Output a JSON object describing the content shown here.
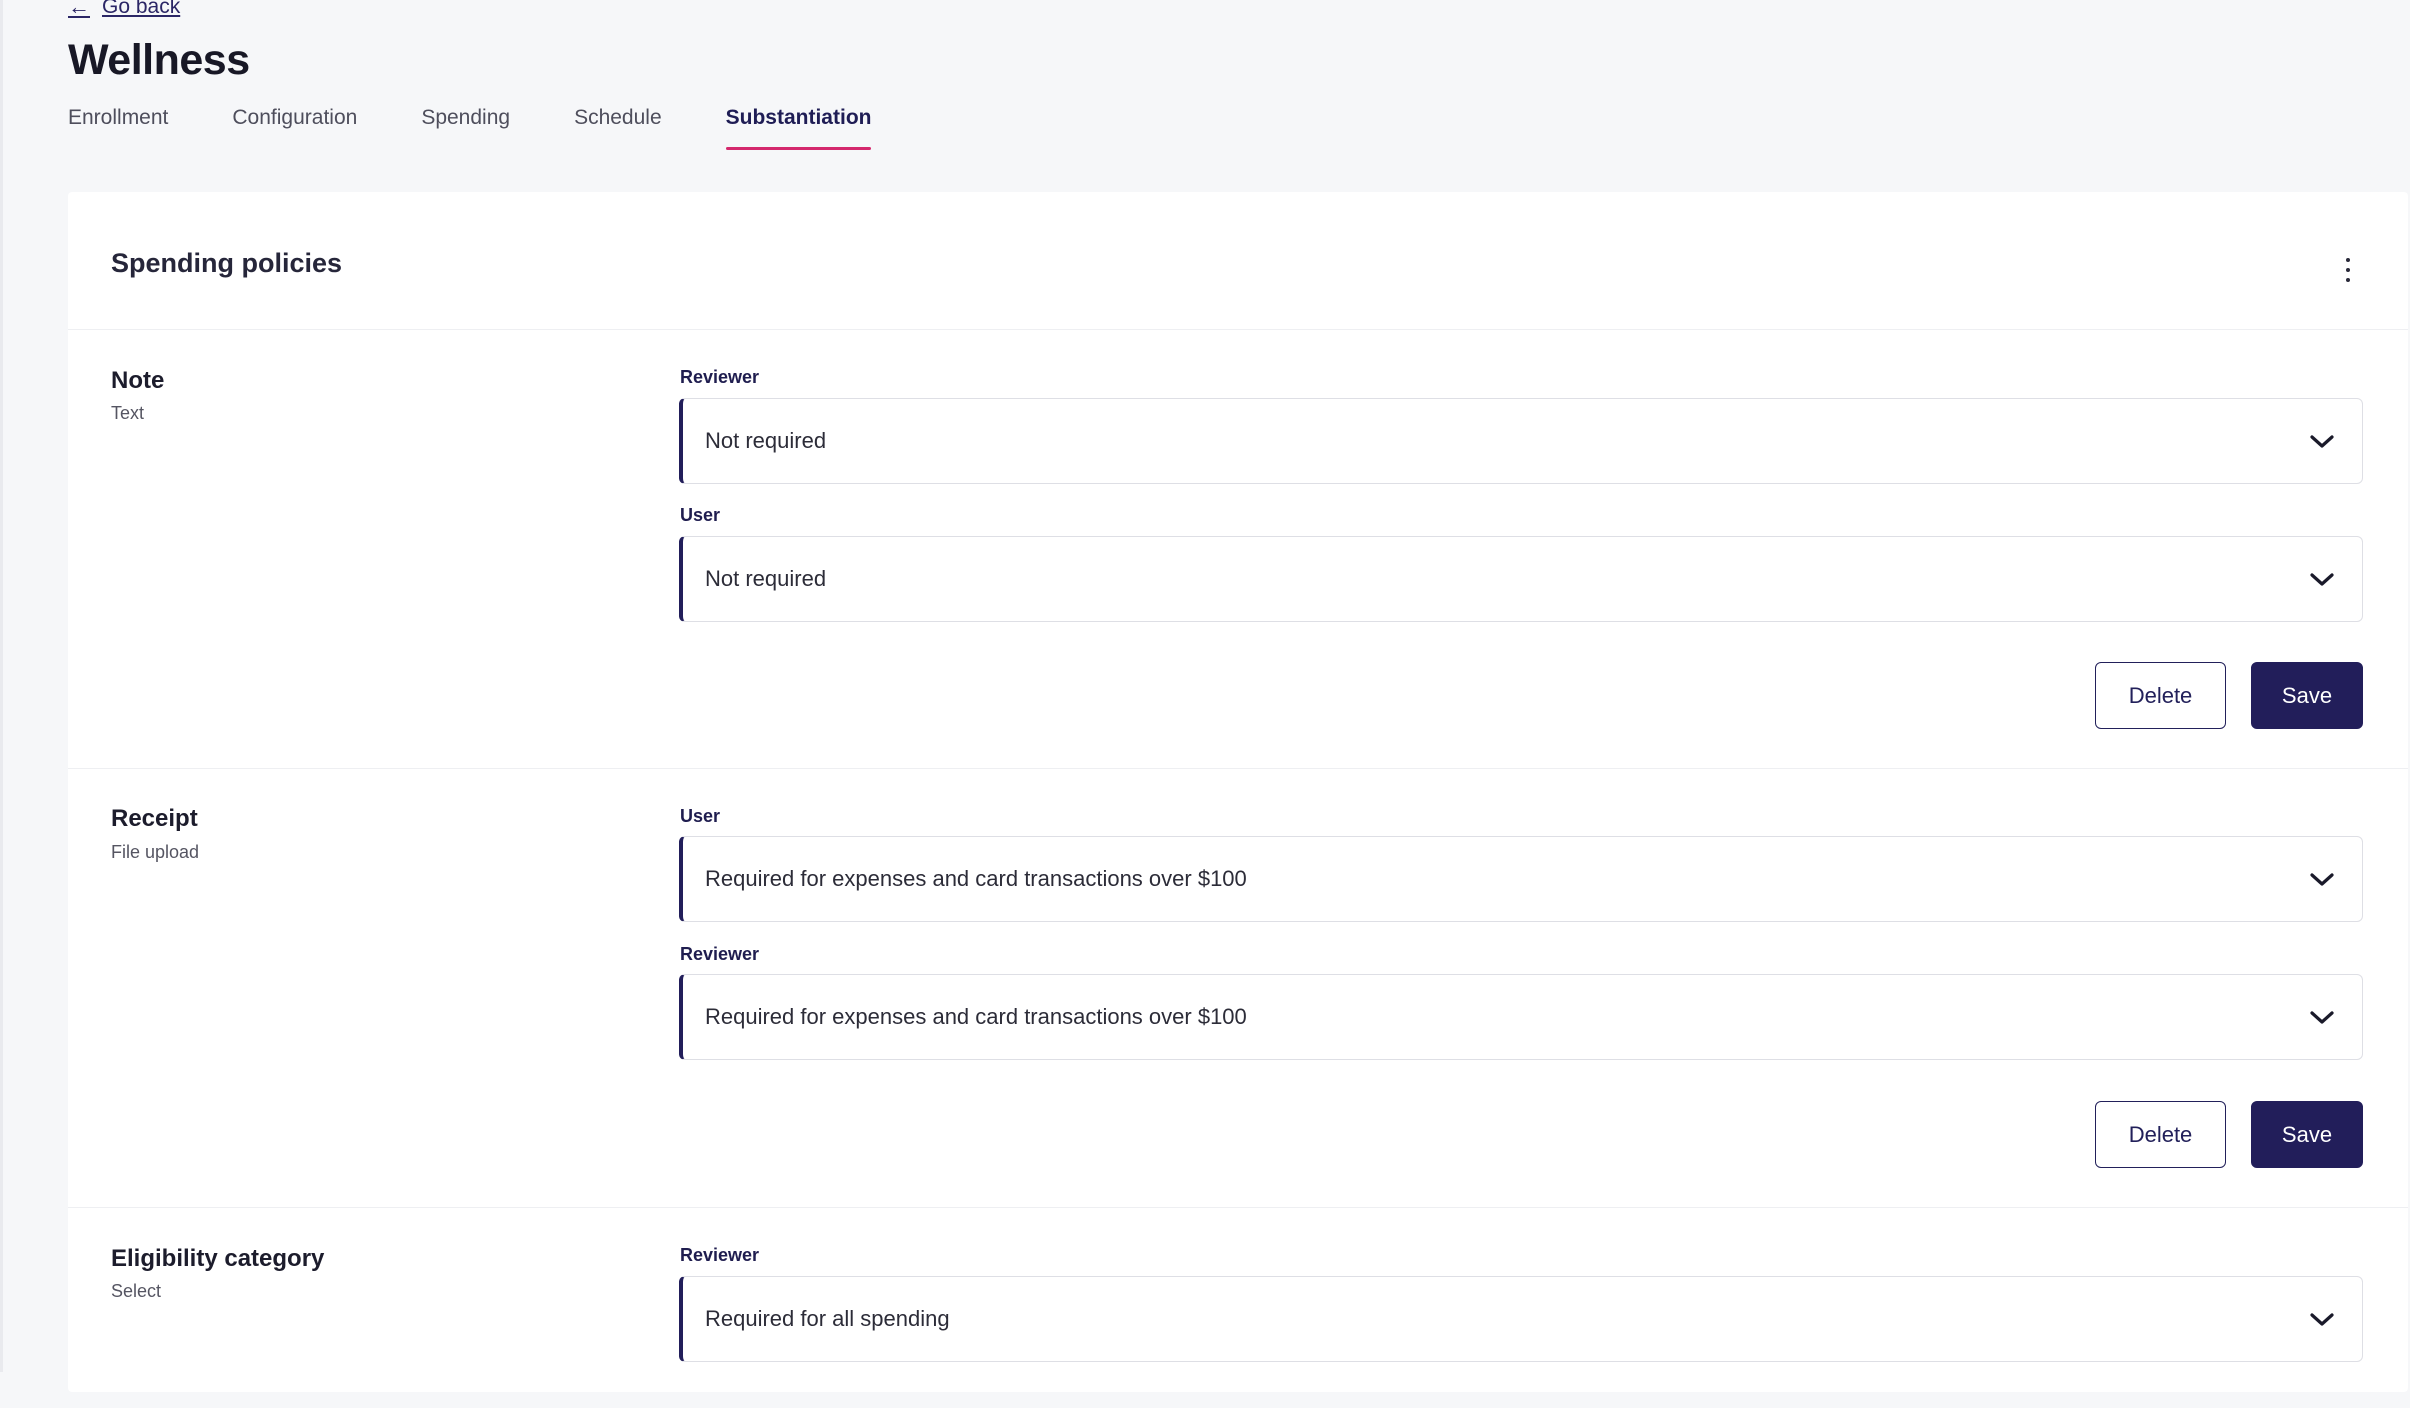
{
  "nav": {
    "back_label": "Go back",
    "back_icon": "arrow-left-icon"
  },
  "page": {
    "title": "Wellness"
  },
  "tabs": [
    {
      "label": "Enrollment",
      "active": false
    },
    {
      "label": "Configuration",
      "active": false
    },
    {
      "label": "Spending",
      "active": false
    },
    {
      "label": "Schedule",
      "active": false
    },
    {
      "label": "Substantiation",
      "active": true
    }
  ],
  "card": {
    "title": "Spending policies",
    "menu_icon": "more-vertical-icon"
  },
  "sections": [
    {
      "name": "Note",
      "type": "Text",
      "fields": [
        {
          "label": "Reviewer",
          "value": "Not required"
        },
        {
          "label": "User",
          "value": "Not required"
        }
      ],
      "delete_label": "Delete",
      "save_label": "Save"
    },
    {
      "name": "Receipt",
      "type": "File upload",
      "fields": [
        {
          "label": "User",
          "value": "Required for expenses and card transactions over $100"
        },
        {
          "label": "Reviewer",
          "value": "Required for expenses and card transactions over $100"
        }
      ],
      "delete_label": "Delete",
      "save_label": "Save"
    },
    {
      "name": "Eligibility category",
      "type": "Select",
      "fields": [
        {
          "label": "Reviewer",
          "value": "Required for all spending"
        }
      ]
    }
  ],
  "colors": {
    "accent": "#d4286d",
    "primary": "#221e5a",
    "background": "#f6f7f9"
  }
}
